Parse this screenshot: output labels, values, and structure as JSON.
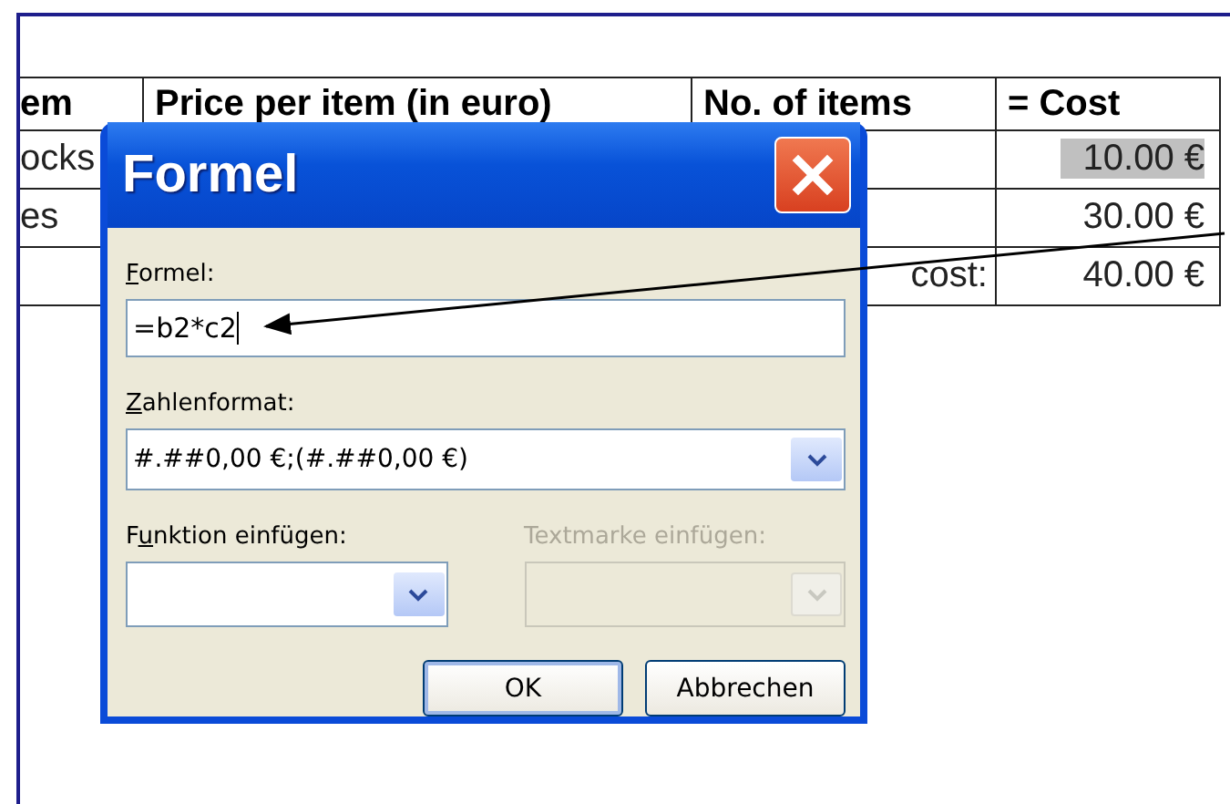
{
  "table": {
    "columns": [
      "em",
      "Price per item (in euro)",
      "No. of items",
      "= Cost"
    ],
    "rows": [
      {
        "item": "ocks",
        "cost": "10.00 €",
        "highlighted": true
      },
      {
        "item": "es",
        "cost": "30.00 €",
        "highlighted": false
      },
      {
        "label": "cost:",
        "cost": "40.00 €",
        "highlighted": false
      }
    ]
  },
  "dialog": {
    "title": "Formel",
    "fields": [
      {
        "kind": "text",
        "label": {
          "key": "F",
          "after": "ormel:"
        },
        "value": "=b2*c2"
      },
      {
        "kind": "dropdown",
        "label": {
          "key": "Z",
          "after": "ahlenformat:"
        },
        "value": "#.##0,00 €;(#.##0,00 €)",
        "disabled": false
      }
    ],
    "half_fields": [
      {
        "kind": "dropdown",
        "label": {
          "before": "F",
          "key": "u",
          "after": "nktion einfügen:"
        },
        "disabled": false
      },
      {
        "kind": "dropdown",
        "label": {
          "before": "Textmarke einfügen:"
        },
        "disabled": true
      }
    ],
    "buttons": [
      {
        "label": "OK",
        "default": true
      },
      {
        "label": "Abbrechen",
        "default": false
      }
    ]
  }
}
